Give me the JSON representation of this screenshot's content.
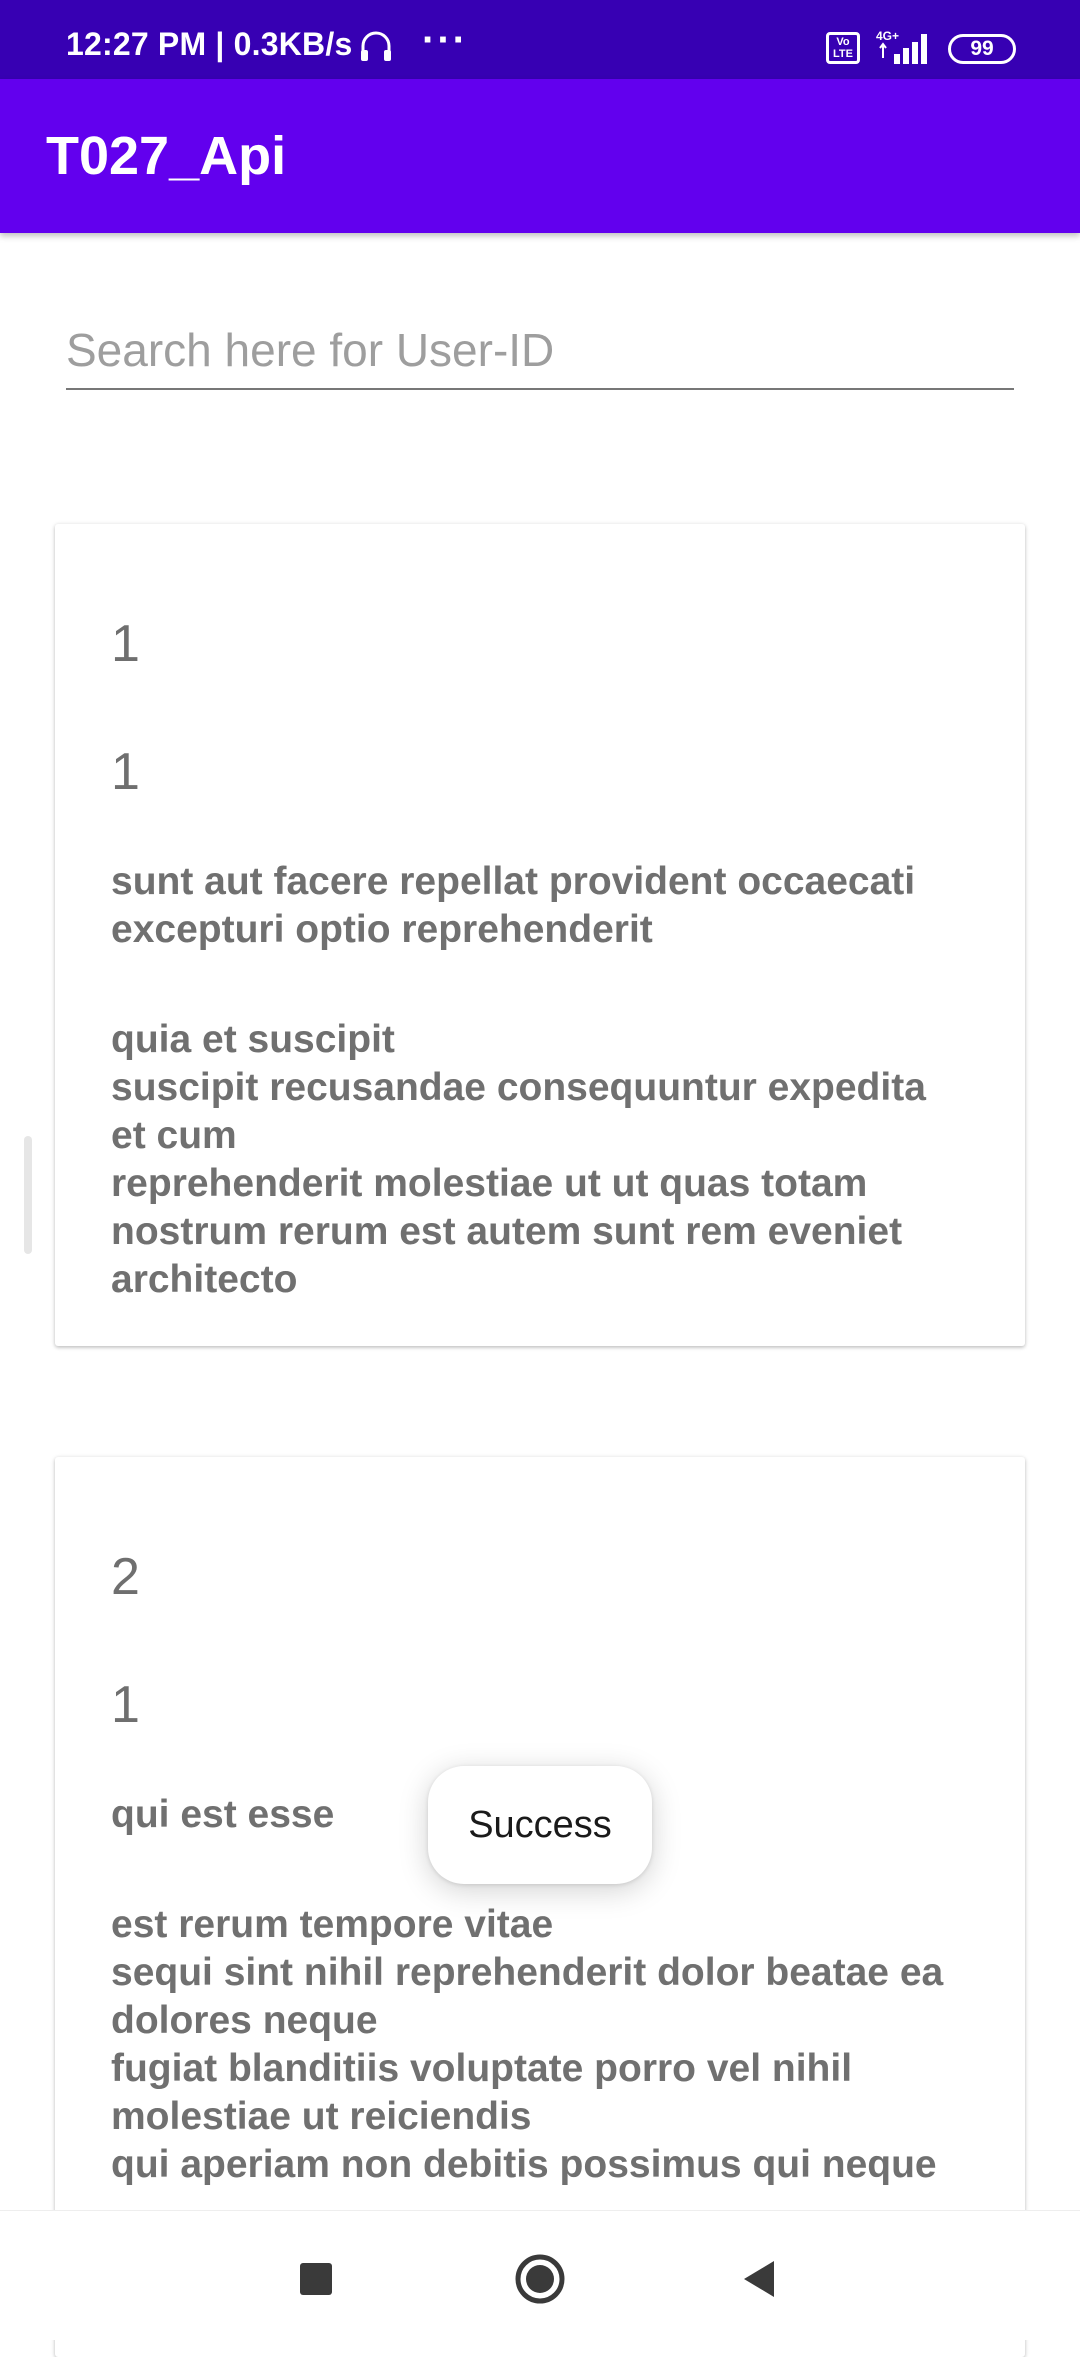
{
  "status_bar": {
    "time": "12:27 PM | 0.3KB/s",
    "more": "···",
    "volte": "Vo LTE",
    "network": "4G+",
    "battery": "99"
  },
  "app_bar": {
    "title": "T027_Api"
  },
  "search": {
    "placeholder": "Search here for User-ID",
    "value": ""
  },
  "posts": [
    {
      "id": "1",
      "user_id": "1",
      "title": "sunt aut facere repellat provident occaecati excepturi optio reprehenderit",
      "body": "quia et suscipit\nsuscipit recusandae consequuntur expedita et cum\nreprehenderit molestiae ut ut quas totam\nnostrum rerum est autem sunt rem eveniet architecto"
    },
    {
      "id": "2",
      "user_id": "1",
      "title": "qui est esse",
      "body": "est rerum tempore vitae\nsequi sint nihil reprehenderit dolor beatae ea dolores neque\nfugiat blanditiis voluptate porro vel nihil molestiae ut reiciendis\nqui aperiam non debitis possimus qui neque"
    }
  ],
  "toast": {
    "message": "Success"
  },
  "nav_bar": {
    "icons": [
      "recents-icon",
      "home-icon",
      "back-icon"
    ]
  },
  "colors": {
    "status_bar": "#3700B3",
    "app_bar": "#6200EE",
    "card_text": "#707070"
  }
}
